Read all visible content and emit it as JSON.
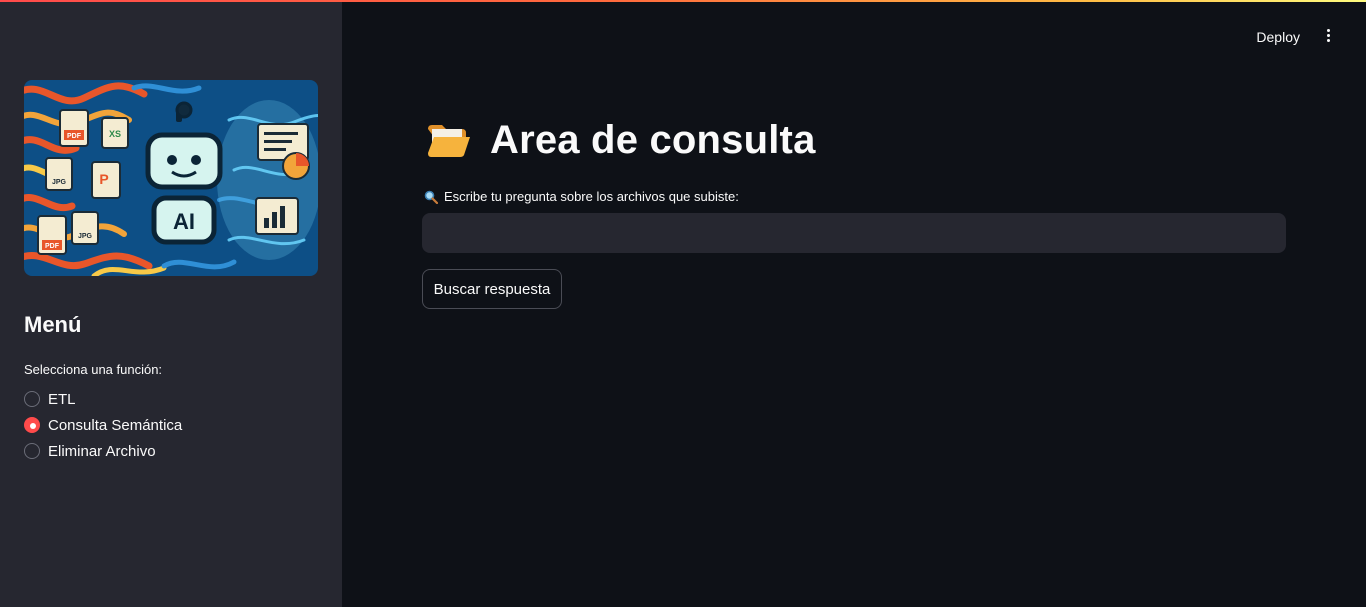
{
  "header": {
    "deploy_label": "Deploy",
    "menu_icon": "kebab-menu-icon"
  },
  "sidebar": {
    "hero_image": {
      "icon": "ai-robot-documents-illustration",
      "robot_badge": "AI",
      "file_badges": [
        "PDF",
        "XS",
        "JPG",
        "P",
        "PDF",
        "JPG"
      ]
    },
    "menu_title": "Menú",
    "radio_label": "Selecciona una función:",
    "options": [
      {
        "label": "ETL",
        "selected": false
      },
      {
        "label": "Consulta Semántica",
        "selected": true
      },
      {
        "label": "Eliminar Archivo",
        "selected": false
      }
    ]
  },
  "main": {
    "title_icon": "open-folder-icon",
    "title": "Area de consulta",
    "question_icon": "magnifying-glass-icon",
    "question_label": "Escribe tu pregunta sobre los archivos que subiste:",
    "question_value": "",
    "button_label": "Buscar respuesta"
  },
  "colors": {
    "sidebar_bg": "#262730",
    "main_bg": "#0e1117",
    "accent": "#ff4b4b",
    "text": "#fafafa"
  }
}
